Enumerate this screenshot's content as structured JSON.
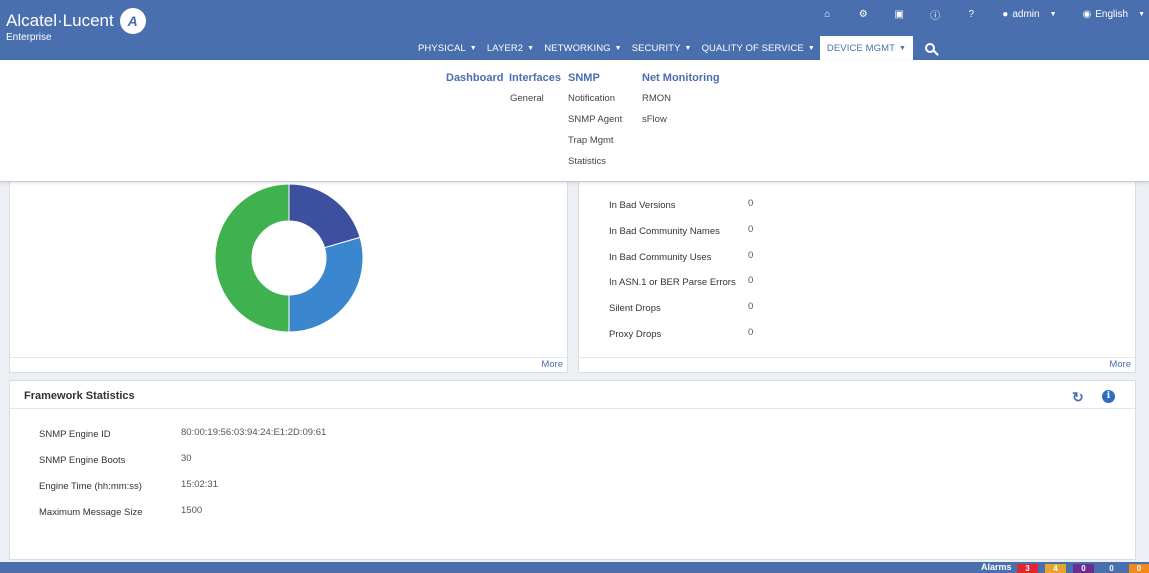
{
  "brand": {
    "name": "Alcatel·Lucent",
    "sub": "Enterprise",
    "logo_glyph": "A"
  },
  "util": {
    "icons": [
      "home-icon",
      "gear-icon",
      "save-icon",
      "info-icon",
      "help-icon"
    ],
    "user": "admin",
    "language": "English"
  },
  "nav": {
    "items": [
      {
        "label": "PHYSICAL"
      },
      {
        "label": "LAYER2"
      },
      {
        "label": "NETWORKING"
      },
      {
        "label": "SECURITY"
      },
      {
        "label": "QUALITY OF SERVICE"
      },
      {
        "label": "DEVICE MGMT",
        "active": true
      }
    ]
  },
  "mega": {
    "dashboard": "Dashboard",
    "interfaces": {
      "title": "Interfaces",
      "links": [
        "General"
      ]
    },
    "snmp": {
      "title": "SNMP",
      "links": [
        "Notification",
        "SNMP Agent",
        "Trap Mgmt",
        "Statistics"
      ]
    },
    "net": {
      "title": "Net Monitoring",
      "links": [
        "RMON",
        "sFlow"
      ]
    }
  },
  "chart": {
    "more": "More"
  },
  "chart_data": {
    "type": "pie",
    "donut": true,
    "slices": [
      {
        "color": "#3d4f9f",
        "fraction": 0.205
      },
      {
        "color": "#3a87cf",
        "fraction": 0.295
      },
      {
        "color": "#3fb14e",
        "fraction": 0.5
      }
    ]
  },
  "snmp_stats": {
    "rows": [
      {
        "label": "In Bad Versions",
        "value": "0"
      },
      {
        "label": "In Bad Community Names",
        "value": "0"
      },
      {
        "label": "In Bad Community Uses",
        "value": "0"
      },
      {
        "label": "In ASN.1 or BER Parse Errors",
        "value": "0"
      },
      {
        "label": "Silent Drops",
        "value": "0"
      },
      {
        "label": "Proxy Drops",
        "value": "0"
      }
    ],
    "more": "More"
  },
  "framework": {
    "title": "Framework Statistics",
    "rows": [
      {
        "label": "SNMP Engine ID",
        "value": "80:00:19:56:03:94:24:E1:2D:09:61"
      },
      {
        "label": "SNMP Engine Boots",
        "value": "30"
      },
      {
        "label": "Engine Time (hh:mm:ss)",
        "value": "15:02:31"
      },
      {
        "label": "Maximum Message Size",
        "value": "1500"
      }
    ]
  },
  "footer": {
    "alarms_label": "Alarms",
    "badges": [
      {
        "value": "3",
        "color": "#e0262f"
      },
      {
        "value": "4",
        "color": "#e4a72b"
      },
      {
        "value": "0",
        "color": "#6a2d91"
      },
      {
        "value": "0",
        "color": "#4a6fae"
      },
      {
        "value": "0",
        "color": "#f08a1d"
      }
    ]
  }
}
